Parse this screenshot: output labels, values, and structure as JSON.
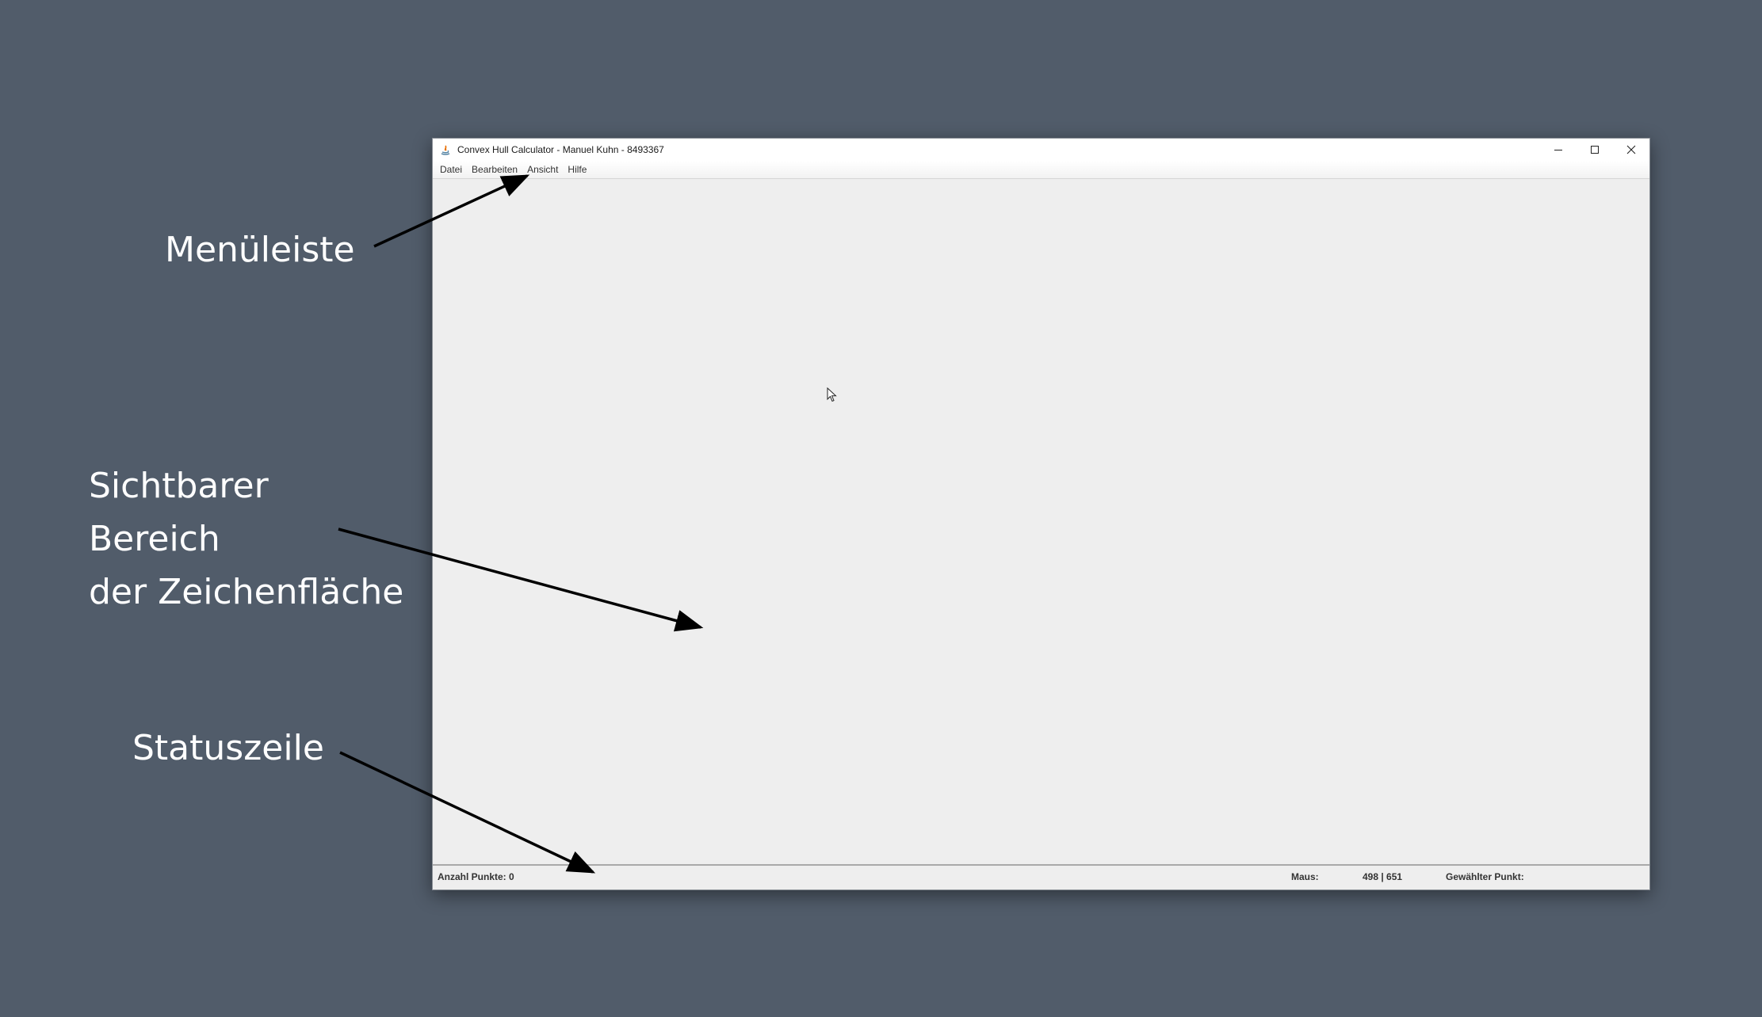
{
  "window": {
    "title": "Convex Hull Calculator - Manuel Kuhn - 8493367",
    "app_icon": "java-app-icon",
    "controls": [
      "minimize-icon",
      "maximize-icon",
      "close-icon"
    ]
  },
  "menubar": {
    "items": [
      {
        "label": "Datei"
      },
      {
        "label": "Bearbeiten"
      },
      {
        "label": "Ansicht"
      },
      {
        "label": "Hilfe"
      }
    ]
  },
  "statusbar": {
    "point_count": "Anzahl Punkte: 0",
    "mouse_label": "Maus:",
    "mouse_value": "498 | 651",
    "selected_label": "Gewählter Punkt:"
  },
  "annotations": {
    "menubar": "Menüleiste",
    "canvas_lines": [
      "Sichtbarer",
      "Bereich",
      "der Zeichenfläche"
    ],
    "statusbar": "Statuszeile"
  },
  "colors": {
    "background": "#515c6a",
    "window": "#eeeeee",
    "arrow": "#000000",
    "annotation_text": "#ffffff"
  }
}
